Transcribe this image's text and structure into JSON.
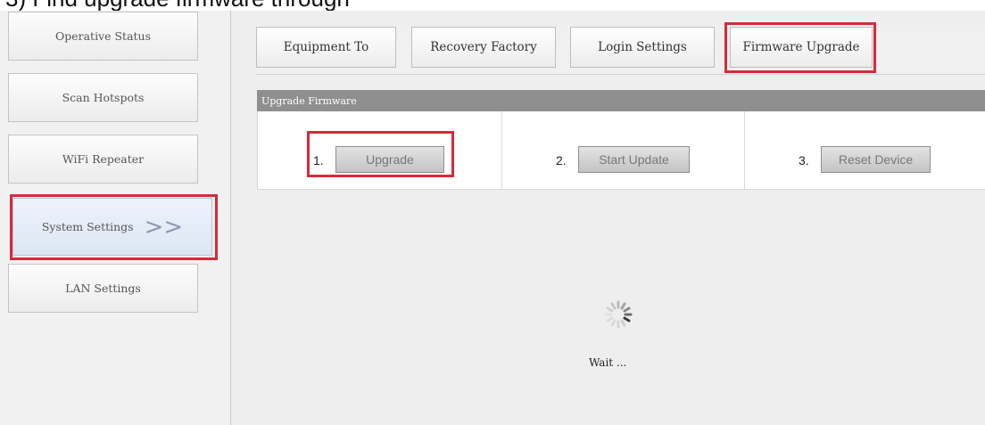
{
  "caption": "3) Find upgrade firmware through",
  "sidebar": {
    "items": [
      {
        "label": "Operative Status"
      },
      {
        "label": "Scan Hotspots"
      },
      {
        "label": "WiFi Repeater"
      },
      {
        "label": "System Settings",
        "arrow": ">>"
      },
      {
        "label": "LAN Settings"
      }
    ]
  },
  "tabs": [
    {
      "label": "Equipment To"
    },
    {
      "label": "Recovery Factory"
    },
    {
      "label": "Login Settings"
    },
    {
      "label": "Firmware Upgrade"
    }
  ],
  "panel": {
    "title": "Upgrade Firmware",
    "steps": [
      {
        "number": "1.",
        "button": "Upgrade"
      },
      {
        "number": "2.",
        "button": "Start Update"
      },
      {
        "number": "3.",
        "button": "Reset Device"
      }
    ]
  },
  "status": {
    "text": "Wait ..."
  },
  "colors": {
    "highlight": "#d8293b",
    "header": "#8f8f8f",
    "active_item": "#dce6f4"
  }
}
